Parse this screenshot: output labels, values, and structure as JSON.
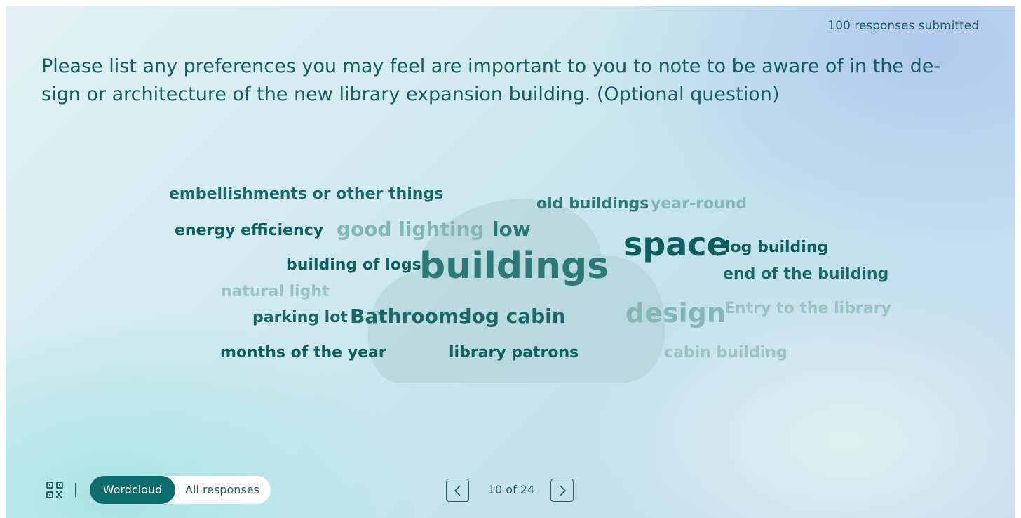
{
  "header": {
    "responses": "100 responses submitted",
    "question": "Please list any preferences you may feel are important to you to note to be aware of in the de-sign or architecture of the new library expansion building. (Optional question)"
  },
  "wordcloud": {
    "words": [
      {
        "id": "w1",
        "text": "embellishments or other things"
      },
      {
        "id": "w2",
        "text": "old buildings"
      },
      {
        "id": "w3",
        "text": "year-round"
      },
      {
        "id": "w4",
        "text": "energy efficiency"
      },
      {
        "id": "w5",
        "text": "good lighting"
      },
      {
        "id": "w6",
        "text": "low"
      },
      {
        "id": "w7",
        "text": "space"
      },
      {
        "id": "w8",
        "text": "log building"
      },
      {
        "id": "w9",
        "text": "building of logs"
      },
      {
        "id": "w10",
        "text": "buildings"
      },
      {
        "id": "w11",
        "text": "end of the building"
      },
      {
        "id": "w12",
        "text": "natural light"
      },
      {
        "id": "w13",
        "text": "parking lot"
      },
      {
        "id": "w14",
        "text": "Bathrooms"
      },
      {
        "id": "w15",
        "text": "log cabin"
      },
      {
        "id": "w16",
        "text": "design"
      },
      {
        "id": "w17",
        "text": "Entry to the library"
      },
      {
        "id": "w18",
        "text": "months of the year"
      },
      {
        "id": "w19",
        "text": "library patrons"
      },
      {
        "id": "w20",
        "text": "cabin building"
      }
    ]
  },
  "footer": {
    "tabs": {
      "wordcloud": "Wordcloud",
      "all_responses": "All responses"
    },
    "pager": "10 of 24",
    "qr_icon": "qr-code-icon",
    "prev_icon": "chevron-left-icon",
    "next_icon": "chevron-right-icon"
  },
  "colors": {
    "accent": "#0d6c6e",
    "text": "#0f5e63"
  }
}
